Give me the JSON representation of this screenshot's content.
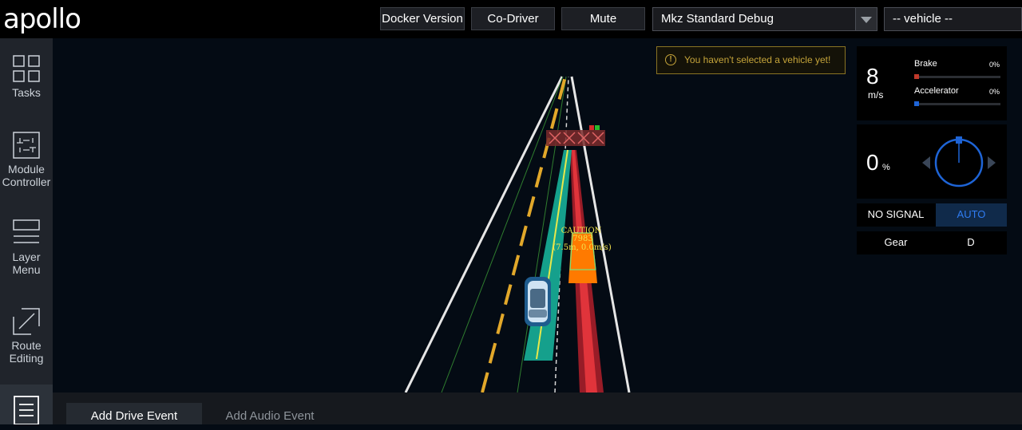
{
  "header": {
    "logo": "apollo",
    "docker_version": "Docker Version",
    "co_driver": "Co-Driver",
    "mute": "Mute",
    "mode_select": "Mkz Standard Debug",
    "vehicle_select": "-- vehicle --"
  },
  "sidebar": {
    "items": [
      {
        "label": "Tasks",
        "icon": "tasks-icon"
      },
      {
        "label": "Module\nController",
        "icon": "module-controller-icon"
      },
      {
        "label": "Layer\nMenu",
        "icon": "layer-menu-icon"
      },
      {
        "label": "Route\nEditing",
        "icon": "route-editing-icon"
      },
      {
        "label": "",
        "icon": "data-recorder-icon"
      }
    ]
  },
  "notification": {
    "text": "You haven't selected a vehicle yet!",
    "icon": "warning-icon"
  },
  "scene": {
    "obstacle_tag": "CAUTION",
    "obstacle_id": "7983",
    "obstacle_info": "(7.5m, 0.0m/s)"
  },
  "dashboard": {
    "speed": "8",
    "speed_unit": "m/s",
    "brake_label": "Brake",
    "brake_value": "0%",
    "brake_level": 0,
    "accelerator_label": "Accelerator",
    "accelerator_value": "0%",
    "accelerator_level": 0,
    "steering": "0",
    "steering_unit": "%",
    "signal": "NO SIGNAL",
    "driving_mode": "AUTO",
    "gear_label": "Gear",
    "gear_value": "D"
  },
  "bottom_tabs": {
    "drive_event": "Add Drive Event",
    "audio_event": "Add Audio Event"
  },
  "colors": {
    "accent_blue": "#1e64d6",
    "brake_red": "#c0392b",
    "lane_yellow": "#e2a82a",
    "path_teal": "#15a08c",
    "path_red": "#d62b2b",
    "caution_orange": "#ff7a00",
    "warning_text": "#c5a43a"
  }
}
